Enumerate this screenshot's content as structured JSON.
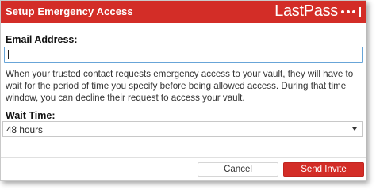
{
  "dialog": {
    "title": "Setup Emergency Access",
    "brand": "LastPass",
    "accent_color": "#d32d27"
  },
  "form": {
    "email_label": "Email Address:",
    "email_value": "",
    "description": "When your trusted contact requests emergency access to your vault, they will have to wait for the period of time you specify before being allowed access. During that time window, you can decline their request to access your vault.",
    "wait_label": "Wait Time:",
    "wait_value": "48 hours"
  },
  "buttons": {
    "cancel_label": "Cancel",
    "send_label": "Send Invite"
  },
  "icons": {
    "logo_dots": "lastpass-dots-icon",
    "dropdown": "chevron-down-icon"
  }
}
